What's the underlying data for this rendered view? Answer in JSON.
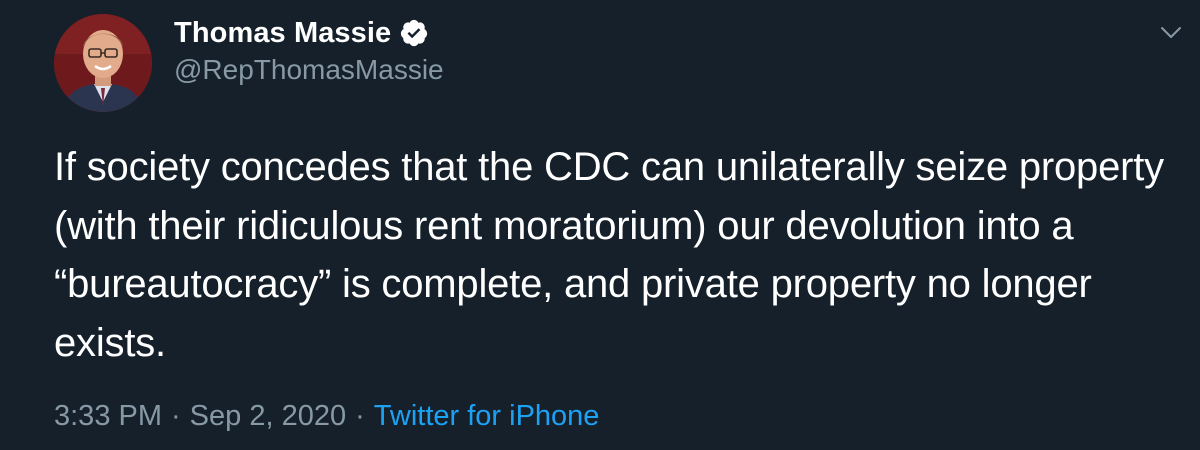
{
  "user": {
    "display_name": "Thomas Massie",
    "handle": "@RepThomasMassie",
    "verified_icon": "verified-badge-icon",
    "avatar_icon": "profile-avatar"
  },
  "tweet": {
    "text": "If society concedes that the CDC can unilaterally seize property (with their ridiculous rent moratorium) our devolution into a “bureautocracy” is complete, and private property no longer exists."
  },
  "meta": {
    "time": "3:33 PM",
    "separator": "·",
    "date": "Sep 2, 2020",
    "source": "Twitter for iPhone"
  },
  "menu": {
    "caret_icon": "chevron-down-icon"
  },
  "colors": {
    "background": "#15202b",
    "text": "#ffffff",
    "secondary": "#8899a6",
    "accent": "#1da1f2"
  }
}
